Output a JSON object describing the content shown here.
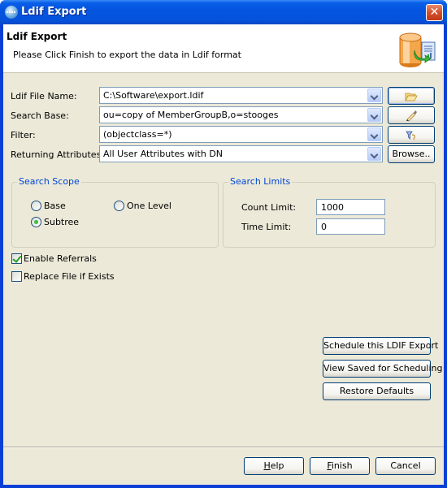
{
  "window": {
    "title": "Ldif Export",
    "title_icon": "app-globe-icon",
    "close_icon": "close-icon"
  },
  "header": {
    "title": "Ldif Export",
    "description": "Please Click Finish to export the data in Ldif format",
    "icon": "database-export-icon"
  },
  "form": {
    "file_name": {
      "label": "Ldif File Name:",
      "value": "C:\\Software\\export.ldif",
      "button_icon": "folder-open-icon"
    },
    "search_base": {
      "label": "Search Base:",
      "value": "ou=copy of MemberGroupB,o=stooges",
      "button_icon": "pen-icon"
    },
    "filter": {
      "label": "Filter:",
      "value": "(objectclass=*)",
      "button_icon": "filter-icon"
    },
    "returning_attributes": {
      "label": "Returning Attributes:",
      "value": "All User Attributes with DN",
      "button_label": "Browse.."
    }
  },
  "search_scope": {
    "title": "Search Scope",
    "options": [
      {
        "label": "Base",
        "checked": false
      },
      {
        "label": "One Level",
        "checked": false
      },
      {
        "label": "Subtree",
        "checked": true
      }
    ]
  },
  "search_limits": {
    "title": "Search Limits",
    "count_limit": {
      "label": "Count Limit:",
      "value": "1000"
    },
    "time_limit": {
      "label": "Time Limit:",
      "value": "0"
    }
  },
  "options": {
    "enable_referrals": {
      "label": "Enable Referrals",
      "checked": true
    },
    "replace_file": {
      "label": "Replace File if Exists",
      "checked": false
    }
  },
  "side_buttons": {
    "schedule": "Schedule this LDIF Export",
    "view_saved": "View Saved for Scheduling",
    "restore": "Restore Defaults"
  },
  "footer": {
    "help_mnemonic": "H",
    "help_rest": "elp",
    "finish_mnemonic": "F",
    "finish_rest": "inish",
    "cancel": "Cancel"
  }
}
